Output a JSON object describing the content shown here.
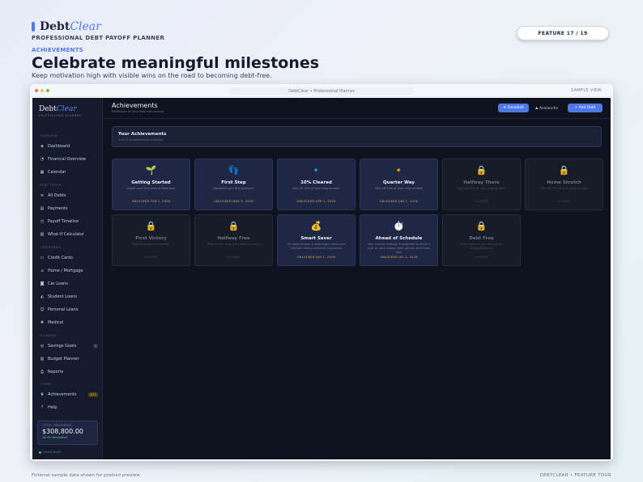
{
  "header": {
    "brand_prefix": "Debt",
    "brand_accent": "Clear",
    "tagline": "PROFESSIONAL DEBT PAYOFF PLANNER",
    "kicker": "ACHIEVEMENTS",
    "headline": "Celebrate meaningful milestones",
    "subhead": "Keep motivation high with visible wins on the road to becoming debt-free.",
    "feature_counter": "FEATURE 17 / 19"
  },
  "window": {
    "url": "DebtClear  •  Professional Planner",
    "sample_view": "SAMPLE VIEW"
  },
  "sidebar": {
    "brand_prefix": "Debt",
    "brand_accent": "Clear",
    "brand_sub": "PROFESSIONAL PLANNER",
    "sections": {
      "overview": "OVERVIEW",
      "debt_tools": "DEBT TOOLS",
      "categories": "CATEGORIES",
      "planning": "PLANNING",
      "other": "OTHER"
    },
    "items": {
      "dashboard": {
        "label": "Dashboard",
        "icon": "dashboard-icon",
        "glyph": "◈"
      },
      "financial_overview": {
        "label": "Financial Overview",
        "icon": "pie-chart-icon",
        "glyph": "◔"
      },
      "calendar": {
        "label": "Calendar",
        "icon": "calendar-icon",
        "glyph": "▦"
      },
      "all_debts": {
        "label": "All Debts",
        "icon": "list-icon",
        "glyph": "≡"
      },
      "payments": {
        "label": "Payments",
        "icon": "receipt-icon",
        "glyph": "▤"
      },
      "payoff_timeline": {
        "label": "Payoff Timeline",
        "icon": "clock-icon",
        "glyph": "◷"
      },
      "what_if": {
        "label": "What-If Calculator",
        "icon": "calculator-icon",
        "glyph": "▧"
      },
      "credit_cards": {
        "label": "Credit Cards",
        "icon": "credit-card-icon",
        "glyph": "▭"
      },
      "home_mortgage": {
        "label": "Home / Mortgage",
        "icon": "house-icon",
        "glyph": "⌂"
      },
      "car_loans": {
        "label": "Car Loans",
        "icon": "car-icon",
        "glyph": "◙"
      },
      "student_loans": {
        "label": "Student Loans",
        "icon": "graduation-cap-icon",
        "glyph": "◭"
      },
      "personal_loans": {
        "label": "Personal Loans",
        "icon": "person-icon",
        "glyph": "☺"
      },
      "medical": {
        "label": "Medical",
        "icon": "hospital-icon",
        "glyph": "✚"
      },
      "savings_goals": {
        "label": "Savings Goals",
        "icon": "target-icon",
        "glyph": "◎",
        "badge": "3"
      },
      "budget_planner": {
        "label": "Budget Planner",
        "icon": "bar-chart-icon",
        "glyph": "▥"
      },
      "reports": {
        "label": "Reports",
        "icon": "printer-icon",
        "glyph": "⎙"
      },
      "achievements": {
        "label": "Achievements",
        "icon": "trophy-icon",
        "glyph": "♛",
        "badge": "4/11"
      },
      "help": {
        "label": "Help",
        "icon": "help-icon",
        "glyph": "?"
      }
    },
    "total": {
      "label": "TOTAL REMAINING",
      "value": "$308,800.00",
      "progress_text": "18.4% eliminated"
    },
    "saved": "Saved locally"
  },
  "main": {
    "title": "Achievements",
    "subtitle": "Milestones on your debt-free journey",
    "buttons": {
      "snowball": "❄ Snowball",
      "avalanche": "⛰ Avalanche",
      "add_debt": "+ Add Debt"
    },
    "summary": {
      "title": "Your Achievements",
      "subtitle": "4 of 11 achievements unlocked"
    },
    "colors": {
      "accent": "#4d79e6",
      "unlocked_text": "#e4b64f",
      "locked_card": "#181c28",
      "unlocked_card": "#1e2744"
    },
    "cards": [
      {
        "name": "Getting Started",
        "desc": "Added your first debt to DebtClear",
        "status": "UNLOCKED FEB 1, 2026",
        "icon": "seedling-icon",
        "glyph": "🌱",
        "locked": false
      },
      {
        "name": "First Step",
        "desc": "Recorded your first payment",
        "status": "UNLOCKED MAR 5, 2026",
        "icon": "footprints-icon",
        "glyph": "👣",
        "locked": false
      },
      {
        "name": "10% Cleared",
        "desc": "Paid off 10% of your original debt",
        "status": "UNLOCKED APR 1, 2026",
        "icon": "blue-diamond-icon",
        "glyph": "🔹",
        "locked": false
      },
      {
        "name": "Quarter Way",
        "desc": "Paid off 25% of your original debt",
        "status": "UNLOCKED JUN 1, 2026",
        "icon": "orange-diamond-icon",
        "glyph": "🔸",
        "locked": false
      },
      {
        "name": "Halfway There",
        "desc": "Paid off 50% of your original debt",
        "status": "LOCKED",
        "icon": "lock-icon",
        "glyph": "🔒",
        "locked": true
      },
      {
        "name": "Home Stretch",
        "desc": "Paid off 75% of your original debt",
        "status": "LOCKED",
        "icon": "lock-icon",
        "glyph": "🔒",
        "locked": true
      },
      {
        "name": "First Victory",
        "desc": "Paid off a debt completely",
        "status": "LOCKED",
        "icon": "lock-icon",
        "glyph": "🔒",
        "locked": true
      },
      {
        "name": "Halfway Free",
        "desc": "Paid off half of all your debt accounts",
        "status": "LOCKED",
        "icon": "lock-icon",
        "glyph": "🔒",
        "locked": true
      },
      {
        "name": "Smart Saver",
        "desc": "On track to save a meaningful amount of interest versus minimum payments",
        "status": "UNLOCKED JUN 1, 2026",
        "icon": "money-bag-icon",
        "glyph": "💰",
        "locked": false
      },
      {
        "name": "Ahead of Schedule",
        "desc": "Your current strategy is projected to finish a year or more sooner than paying minimums only",
        "status": "UNLOCKED JUL 1, 2026",
        "icon": "stopwatch-icon",
        "glyph": "⏱️",
        "locked": false
      },
      {
        "name": "Debt Free",
        "desc": "Every balance has reached $0. Congratulations!",
        "status": "LOCKED",
        "icon": "lock-icon",
        "glyph": "🔒",
        "locked": true
      }
    ]
  },
  "footer": {
    "left": "Fictional sample data shown for product preview",
    "right": "DEBTCLEAR  •  FEATURE TOUR"
  }
}
